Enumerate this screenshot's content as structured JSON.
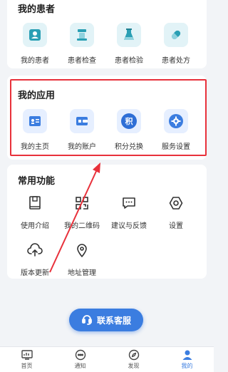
{
  "patients_section": {
    "title": "我的患者",
    "items": [
      {
        "label": "我的患者",
        "icon": "patient-icon"
      },
      {
        "label": "患者检查",
        "icon": "exam-icon"
      },
      {
        "label": "患者检验",
        "icon": "flask-icon"
      },
      {
        "label": "患者处方",
        "icon": "pill-icon"
      }
    ]
  },
  "apps_section": {
    "title": "我的应用",
    "items": [
      {
        "label": "我的主页",
        "icon": "homepage-card-icon"
      },
      {
        "label": "我的账户",
        "icon": "wallet-icon"
      },
      {
        "label": "积分兑换",
        "icon": "points-icon",
        "glyph": "积"
      },
      {
        "label": "服务设置",
        "icon": "gear-icon"
      }
    ]
  },
  "tools_section": {
    "title": "常用功能",
    "items": [
      {
        "label": "使用介绍",
        "icon": "book-icon"
      },
      {
        "label": "我的二维码",
        "icon": "qrcode-icon"
      },
      {
        "label": "建议与反馈",
        "icon": "feedback-icon"
      },
      {
        "label": "设置",
        "icon": "hexagon-settings-icon"
      },
      {
        "label": "版本更新",
        "icon": "cloud-upload-icon"
      },
      {
        "label": "地址管理",
        "icon": "location-pin-icon"
      }
    ]
  },
  "service_button": {
    "label": "联系客服",
    "icon": "headset-icon"
  },
  "tabbar": {
    "items": [
      {
        "label": "首页",
        "icon": "dashboard-icon"
      },
      {
        "label": "通知",
        "icon": "chat-bubble-icon"
      },
      {
        "label": "发现",
        "icon": "compass-icon"
      },
      {
        "label": "我的",
        "icon": "user-icon",
        "active": true
      }
    ]
  },
  "colors": {
    "accent": "#3b7de0",
    "highlight_border": "#e8313b",
    "teal_tile": "#e3f4f8",
    "blue_tile": "#e6efff"
  }
}
